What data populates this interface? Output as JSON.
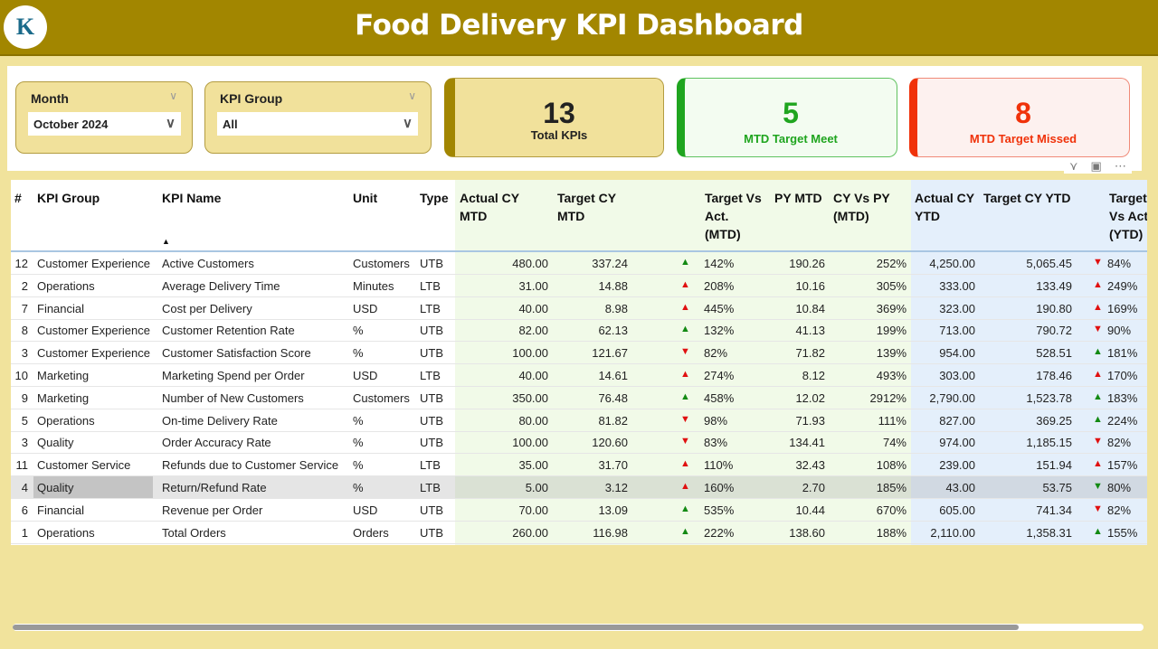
{
  "header": {
    "title": "Food Delivery KPI Dashboard",
    "logo_text": "K"
  },
  "slicers": {
    "month": {
      "label": "Month",
      "value": "October 2024"
    },
    "kpi_group": {
      "label": "KPI Group",
      "value": "All"
    }
  },
  "cards": {
    "total": {
      "value": "13",
      "label": "Total KPIs"
    },
    "meet": {
      "value": "5",
      "label": "MTD Target Meet",
      "color": "#1fa51f"
    },
    "missed": {
      "value": "8",
      "label": "MTD Target Missed",
      "color": "#f0320a"
    }
  },
  "table": {
    "columns": [
      "#",
      "KPI Group",
      "KPI Name",
      "Unit",
      "Type",
      "Actual CY MTD",
      "Target CY MTD",
      "",
      "Target Vs Act. (MTD)",
      "PY MTD",
      "CY Vs PY (MTD)",
      "Actual CY YTD",
      "Target CY YTD",
      "",
      "Target Vs Act. (YTD)"
    ],
    "rows": [
      [
        "12",
        "Customer Experience",
        "Active Customers",
        "Customers",
        "UTB",
        "480.00",
        "337.24",
        "up-green",
        "142%",
        "190.26",
        "252%",
        "4,250.00",
        "5,065.45",
        "down-red",
        "84%"
      ],
      [
        "2",
        "Operations",
        "Average Delivery Time",
        "Minutes",
        "LTB",
        "31.00",
        "14.88",
        "up-red",
        "208%",
        "10.16",
        "305%",
        "333.00",
        "133.49",
        "up-red",
        "249%"
      ],
      [
        "7",
        "Financial",
        "Cost per Delivery",
        "USD",
        "LTB",
        "40.00",
        "8.98",
        "up-red",
        "445%",
        "10.84",
        "369%",
        "323.00",
        "190.80",
        "up-red",
        "169%"
      ],
      [
        "8",
        "Customer Experience",
        "Customer Retention Rate",
        "%",
        "UTB",
        "82.00",
        "62.13",
        "up-green",
        "132%",
        "41.13",
        "199%",
        "713.00",
        "790.72",
        "down-red",
        "90%"
      ],
      [
        "3",
        "Customer Experience",
        "Customer Satisfaction Score",
        "%",
        "UTB",
        "100.00",
        "121.67",
        "down-red",
        "82%",
        "71.82",
        "139%",
        "954.00",
        "528.51",
        "up-green",
        "181%"
      ],
      [
        "10",
        "Marketing",
        "Marketing Spend per Order",
        "USD",
        "LTB",
        "40.00",
        "14.61",
        "up-red",
        "274%",
        "8.12",
        "493%",
        "303.00",
        "178.46",
        "up-red",
        "170%"
      ],
      [
        "9",
        "Marketing",
        "Number of New Customers",
        "Customers",
        "UTB",
        "350.00",
        "76.48",
        "up-green",
        "458%",
        "12.02",
        "2912%",
        "2,790.00",
        "1,523.78",
        "up-green",
        "183%"
      ],
      [
        "5",
        "Operations",
        "On-time Delivery Rate",
        "%",
        "UTB",
        "80.00",
        "81.82",
        "down-red",
        "98%",
        "71.93",
        "111%",
        "827.00",
        "369.25",
        "up-green",
        "224%"
      ],
      [
        "3",
        "Quality",
        "Order Accuracy Rate",
        "%",
        "UTB",
        "100.00",
        "120.60",
        "down-red",
        "83%",
        "134.41",
        "74%",
        "974.00",
        "1,185.15",
        "down-red",
        "82%"
      ],
      [
        "11",
        "Customer Service",
        "Refunds due to Customer Service",
        "%",
        "LTB",
        "35.00",
        "31.70",
        "up-red",
        "110%",
        "32.43",
        "108%",
        "239.00",
        "151.94",
        "up-red",
        "157%"
      ],
      [
        "4",
        "Quality",
        "Return/Refund Rate",
        "%",
        "LTB",
        "5.00",
        "3.12",
        "up-red",
        "160%",
        "2.70",
        "185%",
        "43.00",
        "53.75",
        "down-green",
        "80%"
      ],
      [
        "6",
        "Financial",
        "Revenue per Order",
        "USD",
        "UTB",
        "70.00",
        "13.09",
        "up-green",
        "535%",
        "10.44",
        "670%",
        "605.00",
        "741.34",
        "down-red",
        "82%"
      ],
      [
        "1",
        "Operations",
        "Total Orders",
        "Orders",
        "UTB",
        "260.00",
        "116.98",
        "up-green",
        "222%",
        "138.60",
        "188%",
        "2,110.00",
        "1,358.31",
        "up-green",
        "155%"
      ]
    ],
    "selected_row": 10,
    "sort_column": "KPI Name",
    "colors": {
      "green": "#138a13",
      "red": "#e01010"
    }
  }
}
